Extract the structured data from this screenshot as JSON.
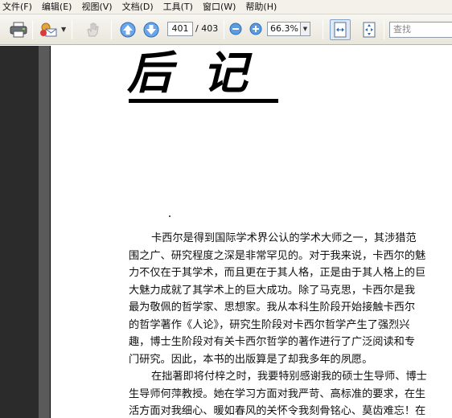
{
  "menu": [
    {
      "label": "文件(F)"
    },
    {
      "label": "编辑(E)"
    },
    {
      "label": "视图(V)"
    },
    {
      "label": "文档(D)"
    },
    {
      "label": "工具(T)"
    },
    {
      "label": "窗口(W)"
    },
    {
      "label": "帮助(H)"
    }
  ],
  "toolbar": {
    "page_current": "401",
    "page_total": "/ 403",
    "zoom": "66.3%",
    "search_placeholder": "查找"
  },
  "document": {
    "title": "后记",
    "paragraphs": [
      {
        "indent": true,
        "text": "卡西尔是得到国际学术界公认的学术大师之一，其涉猎范"
      },
      {
        "indent": false,
        "text": "围之广、研究程度之深是非常罕见的。对于我来说，卡西尔的魅"
      },
      {
        "indent": false,
        "text": "力不仅在于其学术，而且更在于其人格，正是由于其人格上的巨"
      },
      {
        "indent": false,
        "text": "大魅力成就了其学术上的巨大成功。除了马克思，卡西尔是我"
      },
      {
        "indent": false,
        "text": "最为敬佩的哲学家、思想家。我从本科生阶段开始接触卡西尔"
      },
      {
        "indent": false,
        "text": "的哲学著作《人论》，研究生阶段对卡西尔哲学产生了强烈兴"
      },
      {
        "indent": false,
        "text": "趣，博士生阶段对有关卡西尔哲学的著作进行了广泛阅读和专"
      },
      {
        "indent": false,
        "text": "门研究。因此，本书的出版算是了却我多年的夙愿。"
      },
      {
        "indent": true,
        "text": "在拙著即将付梓之时，我要特别感谢我的硕士生导师、博士"
      },
      {
        "indent": false,
        "text": "生导师何萍教授。她在学习方面对我严苛、高标准的要求，在生"
      },
      {
        "indent": false,
        "text": "活方面对我细心、暖如春风的关怀令我刻骨铭心、莫齿难忘！在"
      }
    ]
  }
}
